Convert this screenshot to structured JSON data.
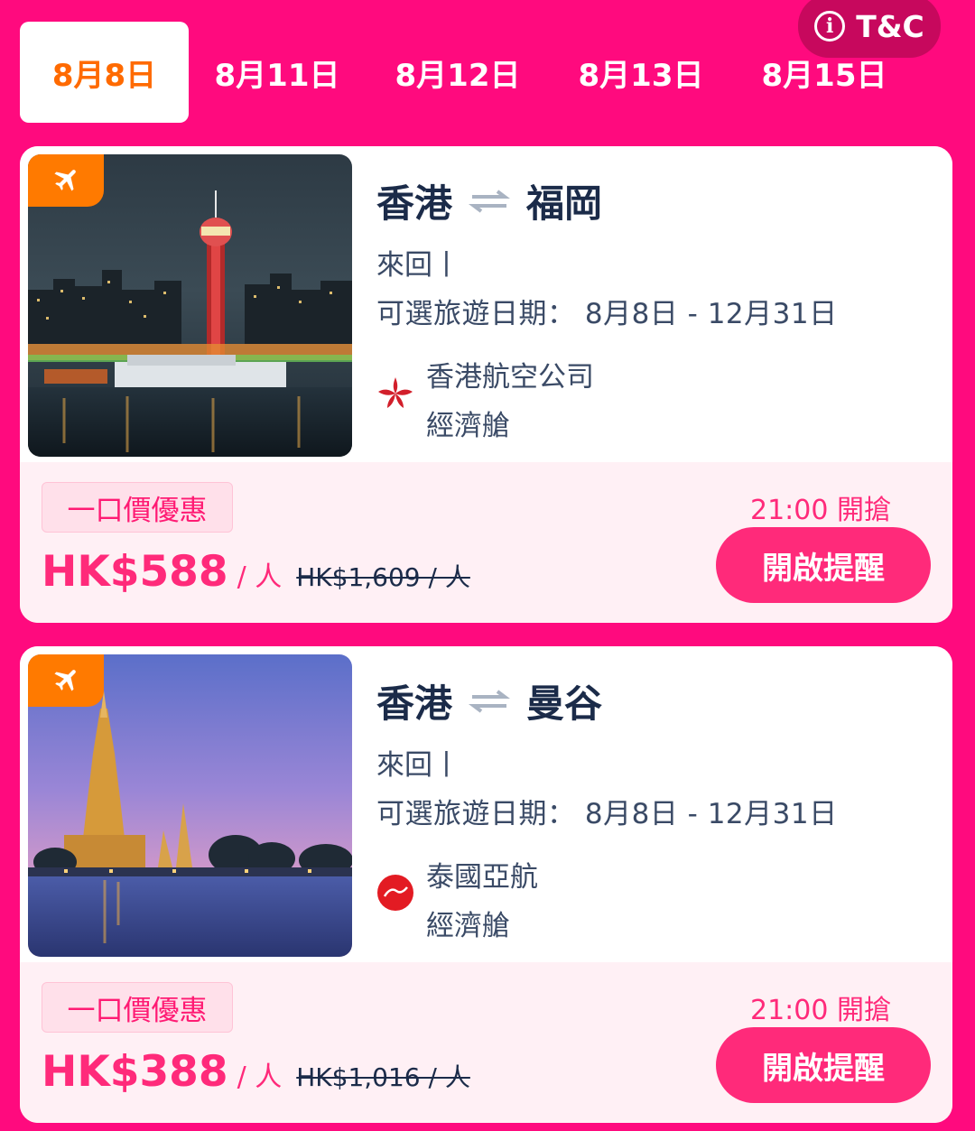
{
  "tc": {
    "label": "T&C"
  },
  "tabs": [
    {
      "label": "8月8日",
      "active": true
    },
    {
      "label": "8月11日",
      "active": false
    },
    {
      "label": "8月12日",
      "active": false
    },
    {
      "label": "8月13日",
      "active": false
    },
    {
      "label": "8月15日",
      "active": false
    }
  ],
  "deals": [
    {
      "origin": "香港",
      "destination": "福岡",
      "trip": "來回丨",
      "dates": "可選旅遊日期： 8月8日  - 12月31日",
      "airline": "香港航空公司",
      "cabin": "經濟艙",
      "badge": "一口價優惠",
      "price": "HK$588",
      "unit": "/ 人",
      "original_price": "HK$1,609 / 人",
      "start_time": "21:00 開搶",
      "button": "開啟提醒"
    },
    {
      "origin": "香港",
      "destination": "曼谷",
      "trip": "來回丨",
      "dates": "可選旅遊日期： 8月8日  - 12月31日",
      "airline": "泰國亞航",
      "cabin": "經濟艙",
      "badge": "一口價優惠",
      "price": "HK$388",
      "unit": "/ 人",
      "original_price": "HK$1,016 / 人",
      "start_time": "21:00 開搶",
      "button": "開啟提醒"
    }
  ],
  "colors": {
    "brand": "#ff0a7e",
    "accent_orange": "#ff7a00",
    "price_pink": "#ff2a7a"
  }
}
